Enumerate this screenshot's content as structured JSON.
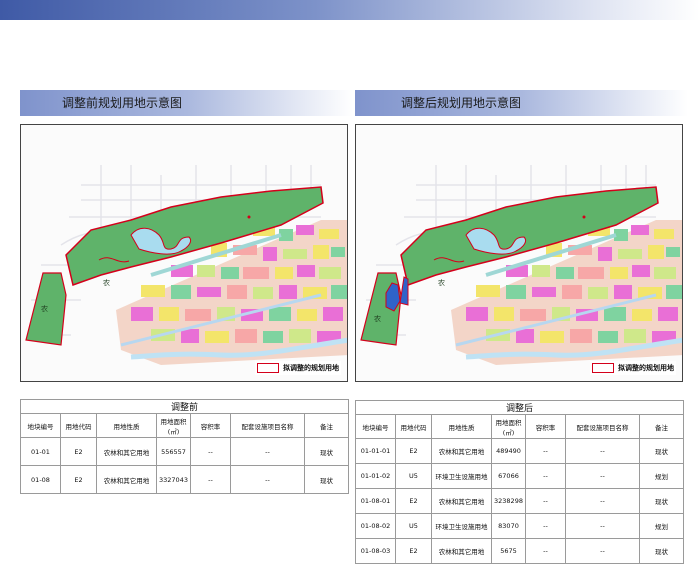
{
  "colors": {
    "top_band": "#3f5aa6",
    "header": "#7f93cc",
    "boundary_red": "#d4001b",
    "green_land": "#5fb36a",
    "water": "#a9dcef",
    "blue_parcel": "#2f63c9"
  },
  "panels": {
    "left": {
      "title": "调整前规划用地示意图",
      "land_label": "农",
      "legend": "拟调整的规划用地"
    },
    "right": {
      "title": "调整后规划用地示意图",
      "land_label": "农",
      "legend": "拟调整的规划用地"
    }
  },
  "table_before": {
    "title": "调整前",
    "headers": [
      "地块编号",
      "用地代码",
      "用地性质",
      "用地面积(㎡)",
      "容积率",
      "配套设施项目名称",
      "备注"
    ],
    "rows": [
      [
        "01-01",
        "E2",
        "农林和其它用地",
        "556557",
        "--",
        "--",
        "现状"
      ],
      [
        "01-08",
        "E2",
        "农林和其它用地",
        "3327043",
        "--",
        "--",
        "现状"
      ]
    ]
  },
  "table_after": {
    "title": "调整后",
    "headers": [
      "地块编号",
      "用地代码",
      "用地性质",
      "用地面积(㎡)",
      "容积率",
      "配套设施项目名称",
      "备注"
    ],
    "rows": [
      [
        "01-01-01",
        "E2",
        "农林和其它用地",
        "489490",
        "--",
        "--",
        "现状"
      ],
      [
        "01-01-02",
        "U5",
        "环境卫生设施用地",
        "67066",
        "--",
        "--",
        "规划"
      ],
      [
        "01-08-01",
        "E2",
        "农林和其它用地",
        "3238298",
        "--",
        "--",
        "现状"
      ],
      [
        "01-08-02",
        "U5",
        "环境卫生设施用地",
        "83070",
        "--",
        "--",
        "规划"
      ],
      [
        "01-08-03",
        "E2",
        "农林和其它用地",
        "5675",
        "--",
        "--",
        "现状"
      ]
    ]
  }
}
